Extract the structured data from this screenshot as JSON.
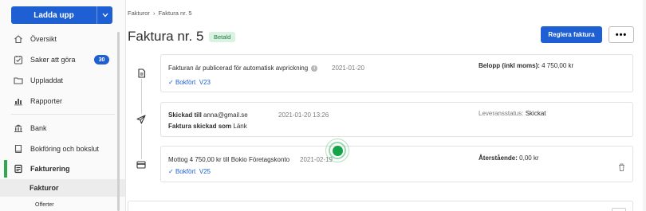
{
  "sidebar": {
    "upload_label": "Ladda upp",
    "items": [
      {
        "label": "Översikt",
        "icon": "home-icon"
      },
      {
        "label": "Saker att göra",
        "icon": "checklist-icon",
        "badge": "30"
      },
      {
        "label": "Uppladdat",
        "icon": "folder-icon"
      },
      {
        "label": "Rapporter",
        "icon": "bar-chart-icon"
      },
      {
        "label": "Bank",
        "icon": "bank-icon"
      },
      {
        "label": "Bokföring och bokslut",
        "icon": "book-icon"
      },
      {
        "label": "Fakturering",
        "icon": "invoice-icon"
      }
    ],
    "sub_items": [
      {
        "label": "Fakturor"
      },
      {
        "label": "Offerter"
      }
    ]
  },
  "breadcrumb": {
    "parent": "Fakturor",
    "separator": "›",
    "current": "Faktura nr. 5"
  },
  "header": {
    "title": "Faktura nr. 5",
    "status": "Betald",
    "settle_label": "Reglera faktura",
    "more_label": "•••"
  },
  "events": [
    {
      "icon": "document-icon",
      "title": "Fakturan är publicerad för automatisk avprickning",
      "date": "2021-01-20",
      "right_label": "Belopp (inkl moms):",
      "right_value": "4 750,00 kr",
      "check": "✓",
      "booked": "Bokfört",
      "voucher": "V23"
    },
    {
      "icon": "paper-plane-icon",
      "title_prefix": "Skickad till",
      "email": "anna@gmail.se",
      "date": "2021-01-20 13:26",
      "delivery_label": "Leveransstatus:",
      "delivery_value": "Skickat",
      "sent_as_bold": "Faktura skickad som",
      "sent_as_value": "Länk"
    },
    {
      "icon": "card-icon",
      "title": "Mottog 4 750,00 kr till Bokio Företagskonto",
      "date": "2021-02-19",
      "right_label": "Återstående:",
      "right_value": "0,00 kr",
      "check": "✓",
      "booked": "Bokfört",
      "voucher": "V25",
      "delete_icon": "trash-icon"
    }
  ],
  "colors": {
    "primary": "#1e5fd4",
    "success": "#16a34a",
    "status_bg": "#d9f2e1"
  }
}
